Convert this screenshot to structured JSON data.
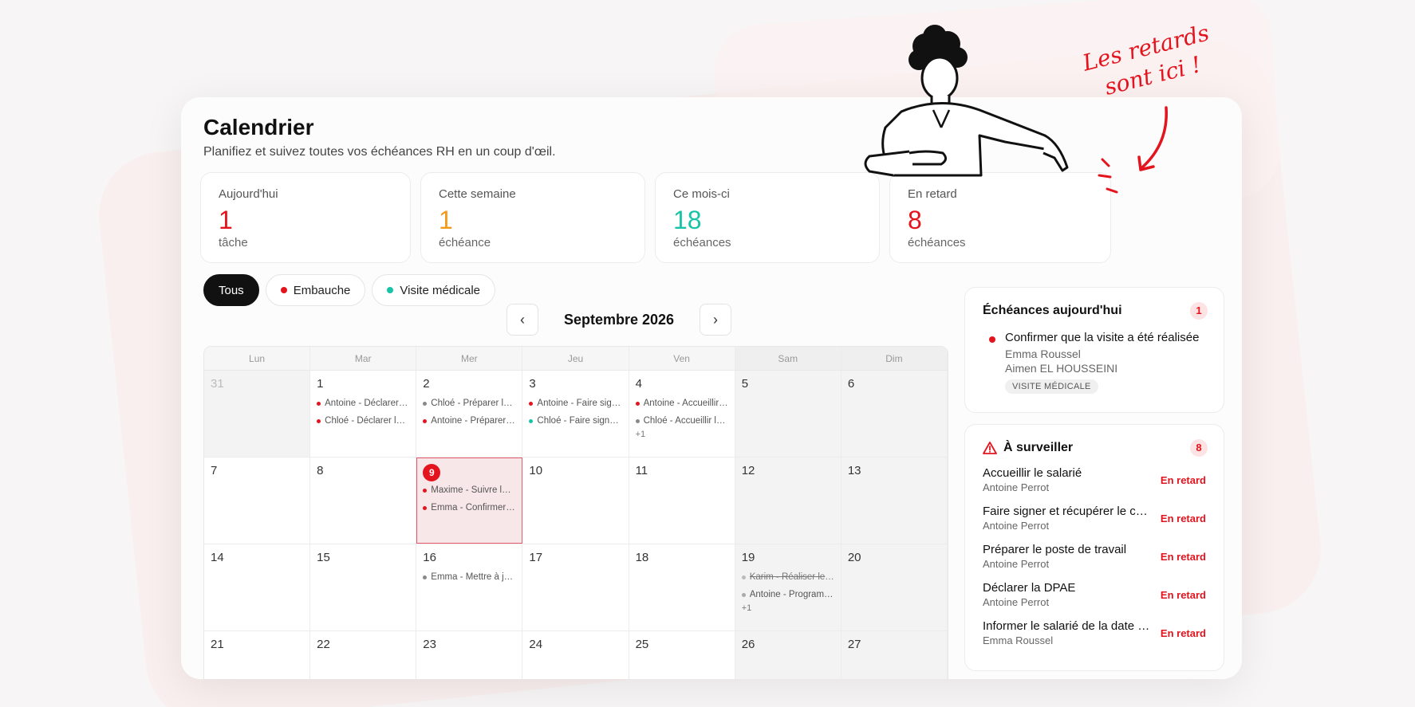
{
  "page": {
    "title": "Calendrier",
    "subtitle": "Planifiez et suivez toutes vos échéances RH en un coup d'œil."
  },
  "stats": [
    {
      "label": "Aujourd'hui",
      "value": "1",
      "unit": "tâche",
      "color": "#e3141e"
    },
    {
      "label": "Cette semaine",
      "value": "1",
      "unit": "échéance",
      "color": "#f29a1b"
    },
    {
      "label": "Ce mois-ci",
      "value": "18",
      "unit": "échéances",
      "color": "#18c4a8"
    },
    {
      "label": "En retard",
      "value": "8",
      "unit": "échéances",
      "color": "#e3141e"
    }
  ],
  "filters": [
    {
      "label": "Tous",
      "active": true
    },
    {
      "label": "Embauche",
      "dot": "#e3141e"
    },
    {
      "label": "Visite médicale",
      "dot": "#18c4a8"
    }
  ],
  "month": {
    "label": "Septembre 2026",
    "prev_icon": "chevron-left-icon",
    "next_icon": "chevron-right-icon"
  },
  "weekdays": [
    "Lun",
    "Mar",
    "Mer",
    "Jeu",
    "Ven",
    "Sam",
    "Dim"
  ],
  "weeks": [
    [
      {
        "day": "31",
        "other": true,
        "events": []
      },
      {
        "day": "1",
        "events": [
          {
            "t": "Antoine - Déclarer la DPAE",
            "c": "#e3141e"
          },
          {
            "t": "Chloé - Déclarer la DPAE",
            "c": "#e3141e"
          }
        ]
      },
      {
        "day": "2",
        "events": [
          {
            "t": "Chloé - Préparer le poste",
            "c": "#888888"
          },
          {
            "t": "Antoine - Préparer le poste",
            "c": "#e3141e"
          }
        ]
      },
      {
        "day": "3",
        "events": [
          {
            "t": "Antoine - Faire signer le contrat",
            "c": "#e3141e"
          },
          {
            "t": "Chloé - Faire signer le contrat",
            "c": "#18c4a8"
          }
        ]
      },
      {
        "day": "4",
        "events": [
          {
            "t": "Antoine - Accueillir le salarié",
            "c": "#e3141e"
          },
          {
            "t": "Chloé - Accueillir le salarié",
            "c": "#888888"
          }
        ],
        "more": "+1"
      },
      {
        "day": "5",
        "we": true,
        "events": []
      },
      {
        "day": "6",
        "we": true,
        "events": []
      }
    ],
    [
      {
        "day": "7",
        "events": []
      },
      {
        "day": "8",
        "events": []
      },
      {
        "day": "9",
        "today": true,
        "events": [
          {
            "t": "Maxime - Suivre la période",
            "c": "#e3141e"
          },
          {
            "t": "Emma - Confirmer la visite",
            "c": "#e3141e"
          }
        ]
      },
      {
        "day": "10",
        "events": []
      },
      {
        "day": "11",
        "events": []
      },
      {
        "day": "12",
        "we": true,
        "events": []
      },
      {
        "day": "13",
        "we": true,
        "events": []
      }
    ],
    [
      {
        "day": "14",
        "events": []
      },
      {
        "day": "15",
        "events": []
      },
      {
        "day": "16",
        "events": [
          {
            "t": "Emma - Mettre à jour le dossier",
            "c": "#888888"
          }
        ]
      },
      {
        "day": "17",
        "events": []
      },
      {
        "day": "18",
        "events": []
      },
      {
        "day": "19",
        "we": true,
        "events": [
          {
            "t": "Karim - Réaliser le bilan",
            "c": "#bbbbbb",
            "strike": true
          },
          {
            "t": "Antoine - Programmer la visite",
            "c": "#aaaaaa"
          }
        ],
        "more": "+1"
      },
      {
        "day": "20",
        "we": true,
        "events": []
      }
    ],
    [
      {
        "day": "21",
        "events": []
      },
      {
        "day": "22",
        "events": []
      },
      {
        "day": "23",
        "events": []
      },
      {
        "day": "24",
        "events": []
      },
      {
        "day": "25",
        "events": []
      },
      {
        "day": "26",
        "we": true,
        "events": []
      },
      {
        "day": "27",
        "we": true,
        "events": []
      }
    ]
  ],
  "today_panel": {
    "title": "Échéances aujourd'hui",
    "count": "1",
    "item": {
      "title": "Confirmer que la visite a été réalisée",
      "person": "Emma Roussel",
      "assignee": "Aimen EL HOUSSEINI",
      "tag": "VISITE MÉDICALE"
    }
  },
  "watch_panel": {
    "title": "À surveiller",
    "count": "8",
    "icon": "warning-icon",
    "items": [
      {
        "title": "Accueillir le salarié",
        "person": "Antoine Perrot",
        "status": "En retard"
      },
      {
        "title": "Faire signer et récupérer le contrat",
        "person": "Antoine Perrot",
        "status": "En retard"
      },
      {
        "title": "Préparer le poste de travail",
        "person": "Antoine Perrot",
        "status": "En retard"
      },
      {
        "title": "Déclarer la DPAE",
        "person": "Antoine Perrot",
        "status": "En retard"
      },
      {
        "title": "Informer le salarié de la date de visite",
        "person": "Emma Roussel",
        "status": "En retard"
      }
    ]
  },
  "annotation": {
    "line1": "Les retards",
    "line2": "sont ici !"
  }
}
